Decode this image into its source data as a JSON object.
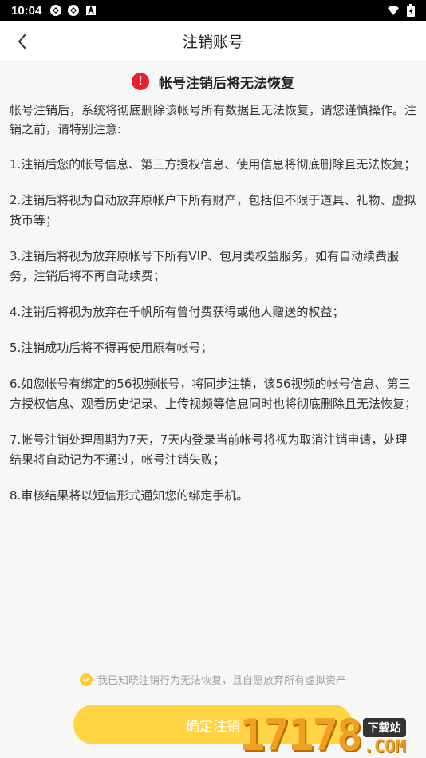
{
  "status_bar": {
    "time": "10:04",
    "left_icons": [
      "sync-icon",
      "sync-icon",
      "a-box-icon"
    ],
    "right_icons": [
      "wifi-icon",
      "battery-icon"
    ]
  },
  "nav": {
    "title": "注销账号",
    "back_icon": "chevron-left-icon"
  },
  "warning": {
    "icon_text": "!",
    "title": "帐号注销后将无法恢复",
    "icon_color": "#e8212c"
  },
  "intro": "帐号注销后，系统将彻底删除该帐号所有数据且无法恢复，请您谨慎操作。注销之前，请特别注意:",
  "rules": [
    "1.注销后您的帐号信息、第三方授权信息、使用信息将彻底删除且无法恢复；",
    "2.注销后将视为自动放弃原帐户下所有财产，包括但不限于道具、礼物、虚拟货币等；",
    "3.注销后将视为放弃原帐号下所有VIP、包月类权益服务，如有自动续费服务，注销后将不再自动续费；",
    "4.注销后将视为放弃在千帆所有曾付费获得或他人赠送的权益；",
    "5.注销成功后将不得再使用原有帐号；",
    "6.如您帐号有绑定的56视频帐号，将同步注销，该56视频的帐号信息、第三方授权信息、观看历史记录、上传视频等信息同时也将彻底删除且无法恢复；",
    "7.帐号注销处理周期为7天，7天内登录当前帐号将视为取消注销申请，处理结果将自动记为不通过，帐号注销失败；",
    "8.审核结果将以短信形式通知您的绑定手机。"
  ],
  "agreement": {
    "text": "我已知晓注销行为无法恢复，且自愿放弃所有虚拟资产",
    "checked": true
  },
  "confirm_button": {
    "label": "确定注销",
    "color": "#ffd544"
  },
  "watermark": {
    "digits": "17178",
    "tag": "下载站",
    "com": ".COM"
  }
}
